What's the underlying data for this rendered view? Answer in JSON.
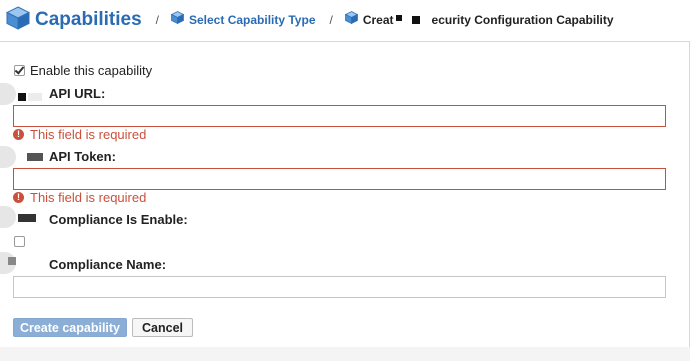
{
  "breadcrumb": {
    "title": "Capabilities",
    "separator": "/",
    "step1": "Select Capability Type",
    "step2_prefix": "Creat",
    "step2_suffix": "ecurity Configuration Capability"
  },
  "form": {
    "enable_label": "Enable this capability",
    "enable_checked": true,
    "fields": [
      {
        "label": "API URL:",
        "value": "",
        "error": "This field is required"
      },
      {
        "label": "API Token:",
        "value": "",
        "error": "This field is required"
      },
      {
        "label": "Compliance Is Enable:",
        "checked": false
      },
      {
        "label": "Compliance Name:",
        "value": ""
      }
    ]
  },
  "buttons": {
    "create": "Create capability",
    "cancel": "Cancel"
  },
  "icons": {
    "error": "!"
  },
  "colors": {
    "link": "#2a6bb3",
    "error": "#c9513c",
    "primary_button": "#8aaed6"
  }
}
